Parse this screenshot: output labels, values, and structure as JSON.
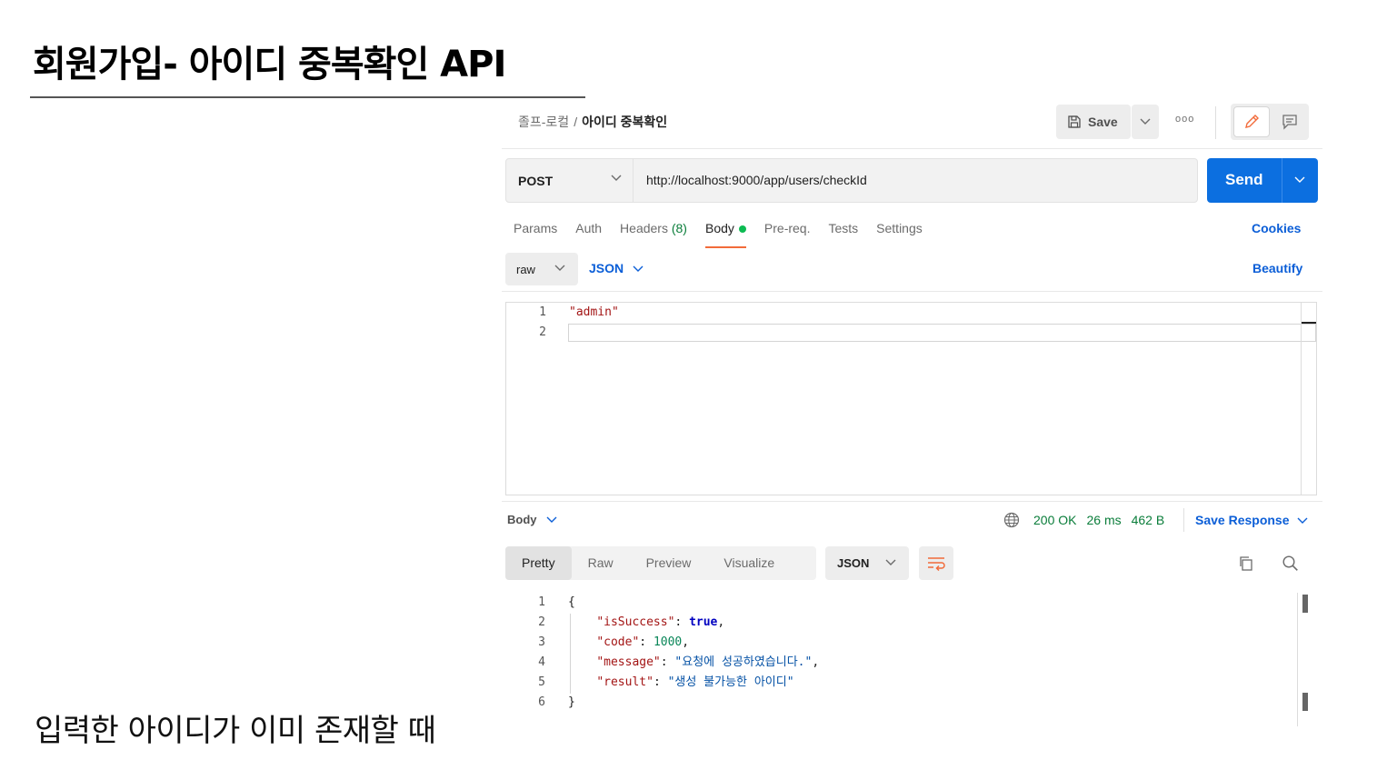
{
  "slide": {
    "title": "회원가입- 아이디 중복확인 API",
    "caption": "입력한 아이디가 이미 존재할 때"
  },
  "header": {
    "collection": "졸프-로컬",
    "separator": "/",
    "request_name": "아이디 중복확인",
    "save_label": "Save",
    "more_label": "ooo"
  },
  "request": {
    "method": "POST",
    "url": "http://localhost:9000/app/users/checkId",
    "send_label": "Send"
  },
  "tabs": {
    "params": "Params",
    "auth": "Auth",
    "headers": "Headers",
    "headers_count": "(8)",
    "body": "Body",
    "prereq": "Pre-req.",
    "tests": "Tests",
    "settings": "Settings",
    "cookies": "Cookies"
  },
  "body_options": {
    "mode": "raw",
    "language": "JSON",
    "beautify": "Beautify"
  },
  "request_body": {
    "lines": [
      {
        "no": "1",
        "text": "\"admin\""
      },
      {
        "no": "2",
        "text": ""
      }
    ]
  },
  "response": {
    "body_label": "Body",
    "status": "200 OK",
    "time": "26 ms",
    "size": "462 B",
    "save_response": "Save Response",
    "view_tabs": [
      "Pretty",
      "Raw",
      "Preview",
      "Visualize"
    ],
    "format": "JSON",
    "lines": [
      {
        "no": "1",
        "open": "{"
      },
      {
        "no": "2",
        "key": "\"isSuccess\"",
        "sep": ": ",
        "value": "true",
        "end": ","
      },
      {
        "no": "3",
        "key": "\"code\"",
        "sep": ": ",
        "value": "1000",
        "end": ","
      },
      {
        "no": "4",
        "key": "\"message\"",
        "sep": ": ",
        "value": "\"요청에 성공하였습니다.\"",
        "end": ","
      },
      {
        "no": "5",
        "key": "\"result\"",
        "sep": ": ",
        "value": "\"생성 불가능한 아이디\"",
        "end": ""
      },
      {
        "no": "6",
        "close": "}"
      }
    ]
  },
  "colors": {
    "send": "#0c6fe0",
    "link": "#0b5ed7",
    "status_ok": "#0a7d3a",
    "active_tab": "#f26b3a",
    "body_dot": "#0cbb52"
  },
  "icons": [
    "save-icon",
    "chevron-down-icon",
    "more-icon",
    "pencil-icon",
    "comment-icon",
    "globe-icon",
    "wrap-lines-icon",
    "copy-icon",
    "search-icon"
  ]
}
